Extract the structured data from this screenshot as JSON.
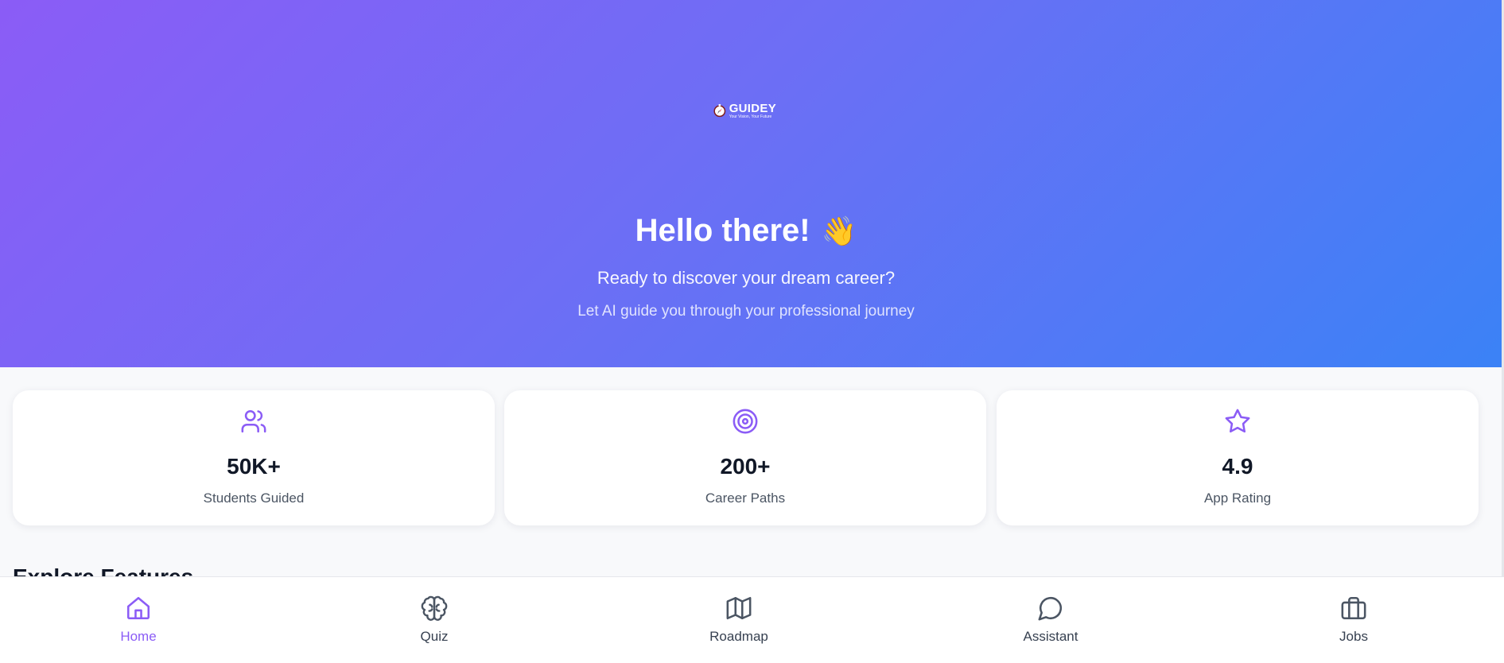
{
  "brand": {
    "name": "GUIDEY",
    "tagline": "Your Vision, Your Future",
    "logo_icon": "compass-icon"
  },
  "hero": {
    "title": "Hello there!",
    "emoji": "👋",
    "subtitle": "Ready to discover your dream career?",
    "tagline": "Let AI guide you through your professional journey",
    "gradient": [
      "#8b5cf6",
      "#3b82f6"
    ]
  },
  "stats": [
    {
      "icon": "users-icon",
      "value": "50K+",
      "label": "Students Guided"
    },
    {
      "icon": "target-icon",
      "value": "200+",
      "label": "Career Paths"
    },
    {
      "icon": "star-icon",
      "value": "4.9",
      "label": "App Rating"
    }
  ],
  "section": {
    "title": "Explore Features"
  },
  "nav": {
    "items": [
      {
        "icon": "home-icon",
        "label": "Home",
        "active": true
      },
      {
        "icon": "brain-icon",
        "label": "Quiz",
        "active": false
      },
      {
        "icon": "map-icon",
        "label": "Roadmap",
        "active": false
      },
      {
        "icon": "chat-bubble-icon",
        "label": "Assistant",
        "active": false
      },
      {
        "icon": "briefcase-icon",
        "label": "Jobs",
        "active": false
      }
    ]
  },
  "colors": {
    "accent": "#8b5cf6",
    "inactive_nav": "#4b5563",
    "text_dark": "#111827"
  }
}
